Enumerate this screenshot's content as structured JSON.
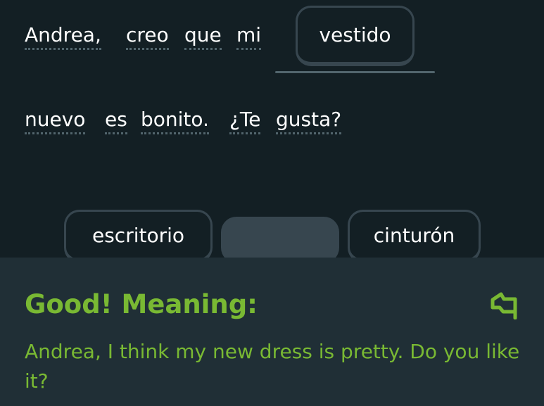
{
  "sentence": {
    "line1_words": [
      "Andrea,",
      "creo",
      "que",
      "mi"
    ],
    "placed_word": "vestido",
    "line2_words": [
      "nuevo",
      "es",
      "bonito.",
      "¿Te",
      "gusta?"
    ]
  },
  "word_bank": [
    {
      "label": "escritorio",
      "used": false
    },
    {
      "label": "",
      "used": true
    },
    {
      "label": "cinturón",
      "used": false
    }
  ],
  "feedback": {
    "title": "Good! Meaning:",
    "translation": "Andrea, I think my new dress is pretty. Do you like it?",
    "icon": "flag-icon"
  },
  "colors": {
    "background": "#131f24",
    "panel": "#202f36",
    "success_green": "#79b933",
    "chip_border": "#37464f",
    "underline": "#52656d"
  }
}
